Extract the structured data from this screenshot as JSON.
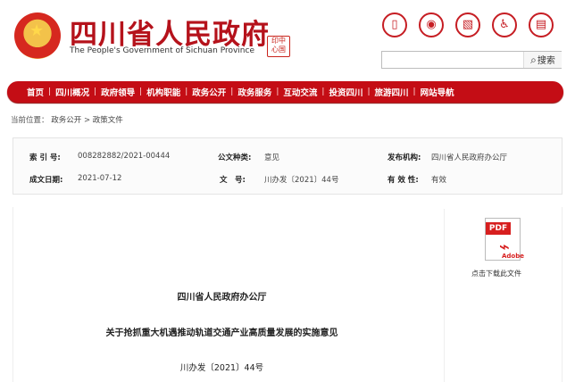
{
  "header": {
    "title": "四川省人民政府",
    "subtitle": "The People's Government of Sichuan Province",
    "seal_text": "印中\n心国",
    "icons": [
      {
        "name": "mobile-icon",
        "glyph": "▯"
      },
      {
        "name": "weibo-icon",
        "glyph": "◉"
      },
      {
        "name": "map-icon",
        "glyph": "▧"
      },
      {
        "name": "accessibility-icon",
        "glyph": "♿"
      },
      {
        "name": "door-icon",
        "glyph": "▤"
      }
    ],
    "search": {
      "placeholder": "",
      "button_label": "搜索"
    }
  },
  "nav": {
    "items": [
      "首页",
      "四川概况",
      "政府领导",
      "机构职能",
      "政务公开",
      "政务服务",
      "互动交流",
      "投资四川",
      "旅游四川",
      "网站导航"
    ]
  },
  "breadcrumb": {
    "prefix": "当前位置：",
    "items": [
      "政务公开",
      "政策文件"
    ],
    "separator": " > "
  },
  "meta": {
    "index_label": "索 引 号:",
    "index_value": "008282882/2021-00444",
    "type_label": "公文种类:",
    "type_value": "意见",
    "issuer_label": "发布机构:",
    "issuer_value": "四川省人民政府办公厅",
    "date_label": "成文日期:",
    "date_value": "2021-07-12",
    "document_label": "文　号:",
    "document_value": "川办发〔2021〕44号",
    "validity_label": "有 效 性:",
    "validity_value": "有效"
  },
  "attachment": {
    "pdf_badge": "PDF",
    "pdf_brand": "Adobe",
    "download_label": "点击下载此文件"
  },
  "document": {
    "issuer": "四川省人民政府办公厅",
    "title": "关于抢抓重大机遇推动轨道交通产业高质量发展的实施意见",
    "number": "川办发〔2021〕44号"
  },
  "colors": {
    "brand_red": "#c40d15",
    "title_red": "#b5121b",
    "nav_text": "#ffffff"
  }
}
